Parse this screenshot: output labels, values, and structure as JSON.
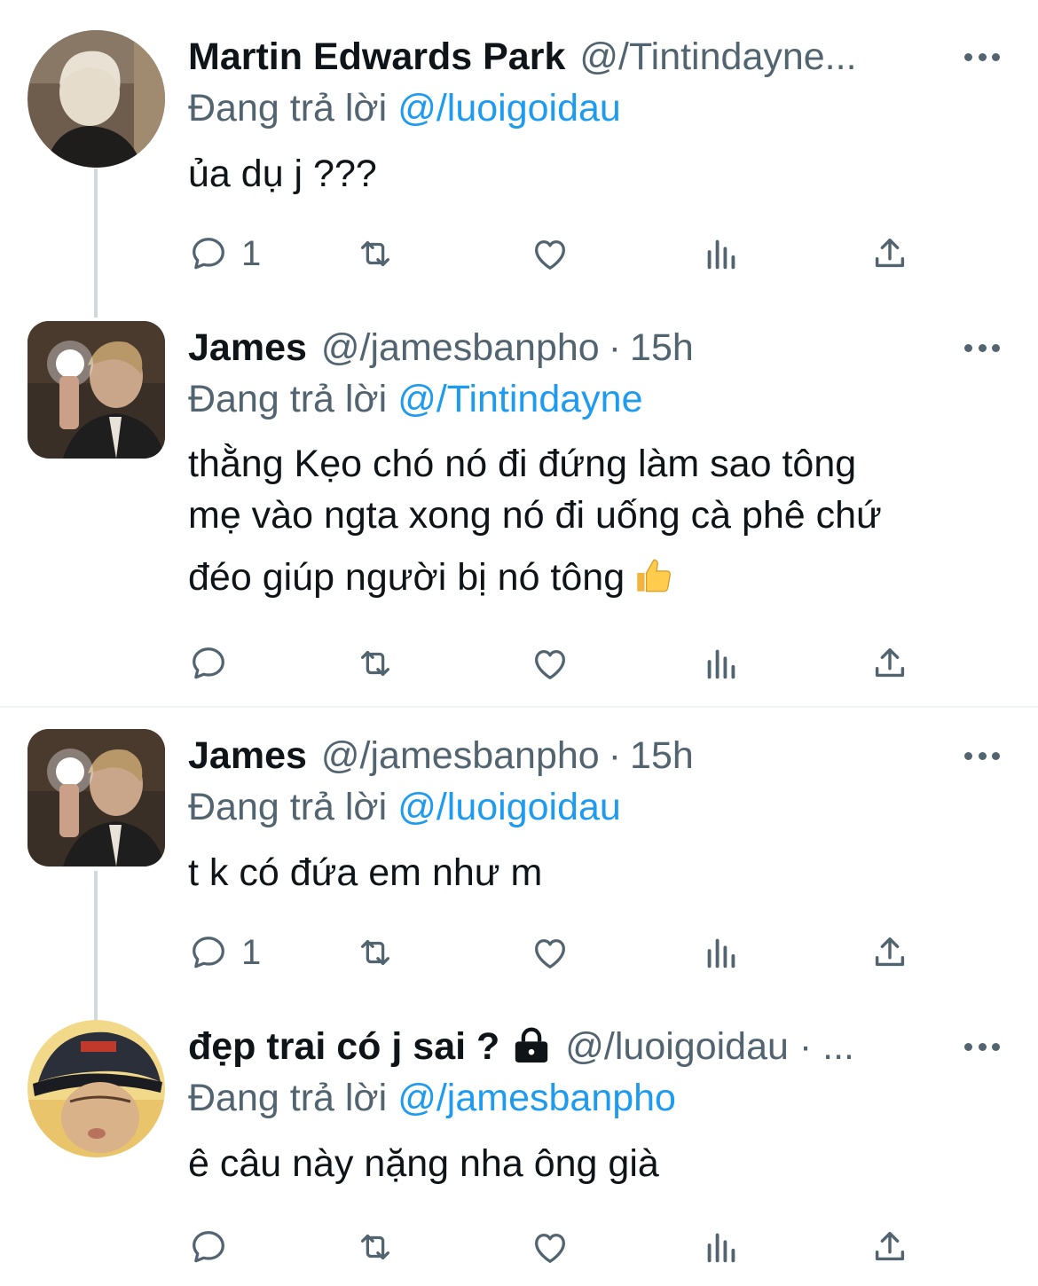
{
  "tweets": [
    {
      "name": "Martin Edwards Park",
      "handle": "@/Tintindayne...",
      "separator": "",
      "time": "",
      "reply_prefix": "Đang trả lời",
      "reply_to": "@/luoigoidau",
      "lines": [
        "ủa dụ j ???"
      ],
      "reply_count": "1"
    },
    {
      "name": "James",
      "handle": "@/jamesbanpho",
      "separator": "·",
      "time": "15h",
      "reply_prefix": "Đang trả lời",
      "reply_to": "@/Tintindayne",
      "lines": [
        "thằng Kẹo chó nó đi đứng làm sao tông",
        "mẹ vào ngta xong nó đi uống cà phê chứ",
        "đéo giúp người bị nó tông"
      ],
      "reply_count": ""
    },
    {
      "name": "James",
      "handle": "@/jamesbanpho",
      "separator": "·",
      "time": "15h",
      "reply_prefix": "Đang trả lời",
      "reply_to": "@/luoigoidau",
      "lines": [
        "t k có đứa em như m"
      ],
      "reply_count": "1"
    },
    {
      "name": "đẹp trai có j sai ?",
      "handle": "@/luoigoidau · ...",
      "separator": "",
      "time": "",
      "reply_prefix": "Đang trả lời",
      "reply_to": "@/jamesbanpho",
      "lines": [
        "ê câu này nặng nha ông già"
      ],
      "reply_count": ""
    }
  ],
  "icons": {
    "reply": "speech-bubble-icon",
    "retweet": "retweet-icon",
    "like": "heart-icon",
    "views": "bar-chart-icon",
    "share": "share-upload-icon",
    "more": "more-dots-icon",
    "lock": "lock-icon",
    "emoji": "thumbs-up-emoji"
  },
  "colors": {
    "text": "#0f1419",
    "secondary": "#536471",
    "link": "#1d9bf0",
    "thread_line": "#cfd9de"
  }
}
